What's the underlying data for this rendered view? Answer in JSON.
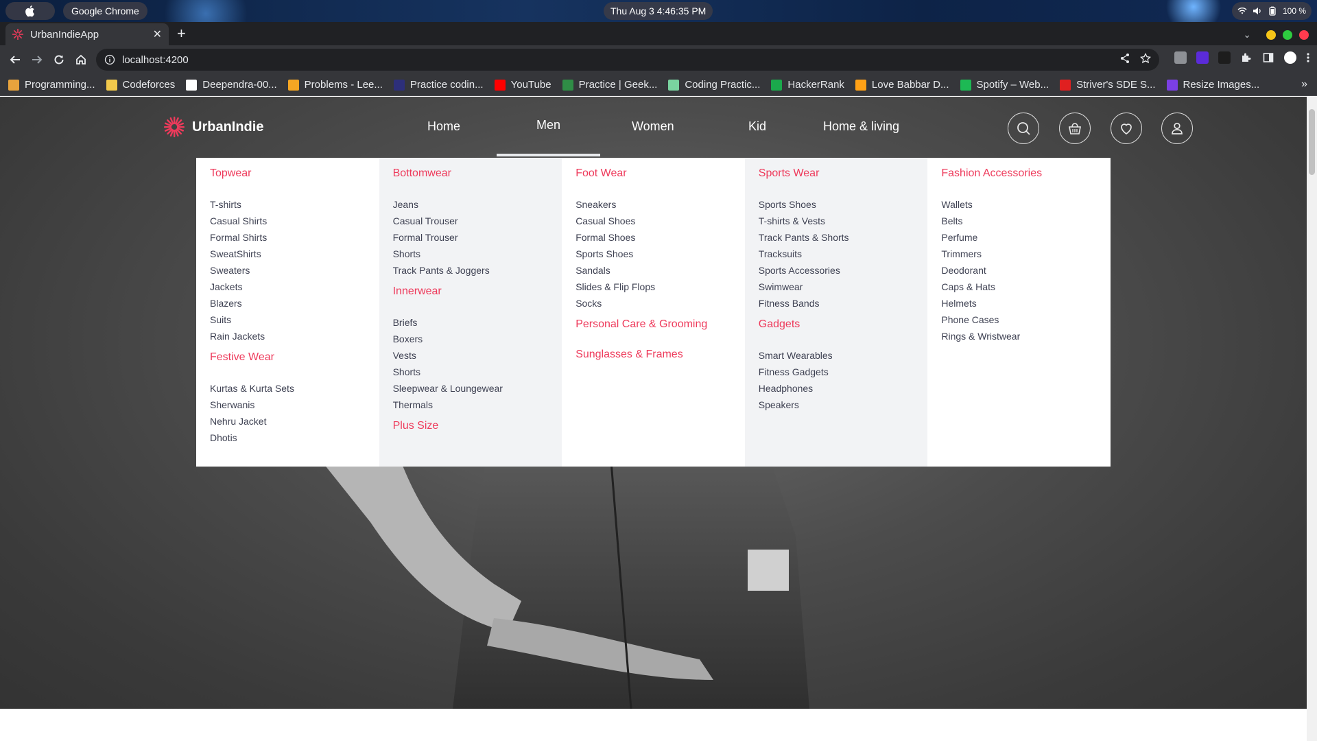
{
  "os": {
    "app_name": "Google Chrome",
    "clock": "Thu Aug 3   4:46:35 PM",
    "battery": "100 %"
  },
  "browser": {
    "tab_title": "UrbanIndieApp",
    "url": "localhost:4200",
    "bookmarks": [
      {
        "label": "Programming...",
        "color": "#e8a33d"
      },
      {
        "label": "Codeforces",
        "color": "#f2c94c"
      },
      {
        "label": "Deependra-00...",
        "color": "#ffffff"
      },
      {
        "label": "Problems - Lee...",
        "color": "#f5a623"
      },
      {
        "label": "Practice codin...",
        "color": "#2d2f7a"
      },
      {
        "label": "YouTube",
        "color": "#ff0000"
      },
      {
        "label": "Practice | Geek...",
        "color": "#2f8d46"
      },
      {
        "label": "Coding Practic...",
        "color": "#7ad3a0"
      },
      {
        "label": "HackerRank",
        "color": "#1ba94c"
      },
      {
        "label": "Love Babbar D...",
        "color": "#ffa116"
      },
      {
        "label": "Spotify – Web...",
        "color": "#1db954"
      },
      {
        "label": "Striver's SDE S...",
        "color": "#e02020"
      },
      {
        "label": "Resize Images...",
        "color": "#7b3fe4"
      }
    ],
    "more_bookmarks": "»"
  },
  "site": {
    "brand": "UrbanIndie",
    "accent_color": "#ee3a5b",
    "nav": [
      {
        "label": "Home"
      },
      {
        "label": "Men"
      },
      {
        "label": "Women"
      },
      {
        "label": "Kid"
      },
      {
        "label": "Home & living"
      }
    ],
    "icons": [
      "search-icon",
      "basket-icon",
      "heart-icon",
      "user-icon"
    ]
  },
  "mega_menu": [
    {
      "groups": [
        {
          "title": "Topwear",
          "items": [
            "T-shirts",
            "Casual Shirts",
            "Formal Shirts",
            "SweatShirts",
            "Sweaters",
            "Jackets",
            "Blazers",
            "Suits",
            "Rain Jackets"
          ]
        },
        {
          "title": "Festive Wear",
          "items": [
            "Kurtas & Kurta Sets",
            "Sherwanis",
            "Nehru Jacket",
            "Dhotis"
          ]
        }
      ]
    },
    {
      "groups": [
        {
          "title": "Bottomwear",
          "items": [
            "Jeans",
            "Casual Trouser",
            "Formal Trouser",
            "Shorts",
            "Track Pants & Joggers"
          ]
        },
        {
          "title": "Innerwear",
          "items": [
            "Briefs",
            "Boxers",
            "Vests",
            "Shorts",
            "Sleepwear & Loungewear",
            "Thermals"
          ]
        },
        {
          "title": "Plus Size",
          "items": []
        }
      ]
    },
    {
      "groups": [
        {
          "title": "Foot Wear",
          "items": [
            "Sneakers",
            "Casual Shoes",
            "Formal Shoes",
            "Sports Shoes",
            "Sandals",
            "Slides & Flip Flops",
            "Socks"
          ]
        },
        {
          "title": "Personal Care & Grooming",
          "items": []
        },
        {
          "title": "Sunglasses & Frames",
          "items": []
        }
      ]
    },
    {
      "groups": [
        {
          "title": "Sports Wear",
          "items": [
            "Sports Shoes",
            "T-shirts & Vests",
            "Track Pants & Shorts",
            "Tracksuits",
            "Sports Accessories",
            "Swimwear",
            "Fitness Bands"
          ]
        },
        {
          "title": "Gadgets",
          "items": [
            "Smart Wearables",
            "Fitness Gadgets",
            "Headphones",
            "Speakers"
          ]
        }
      ]
    },
    {
      "groups": [
        {
          "title": "Fashion Accessories",
          "items": [
            "Wallets",
            "Belts",
            "Perfume",
            "Trimmers",
            "Deodorant",
            "Caps & Hats",
            "Helmets",
            "Phone Cases",
            "Rings & Wristwear"
          ]
        }
      ]
    }
  ]
}
